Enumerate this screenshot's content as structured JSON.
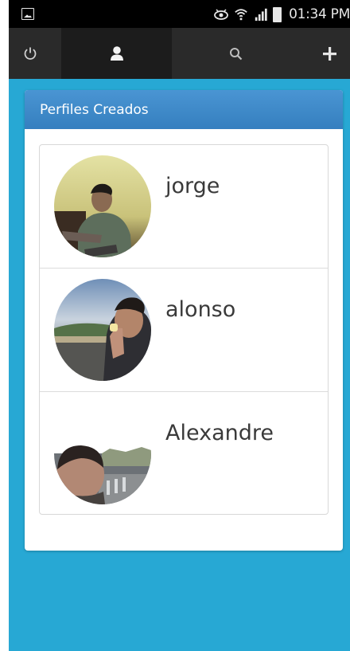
{
  "status_bar": {
    "time": "01:34 PM",
    "icons": [
      "image-notification-icon",
      "eye-icon",
      "wifi-icon",
      "signal-icon",
      "battery-icon"
    ]
  },
  "action_bar": {
    "tabs": [
      {
        "name": "power-icon",
        "active": false
      },
      {
        "name": "user-icon",
        "active": true
      },
      {
        "name": "search-icon",
        "active": false
      },
      {
        "name": "plus-icon",
        "active": false
      }
    ]
  },
  "panel": {
    "title": "Perfiles Creados"
  },
  "profiles": [
    {
      "name": "jorge"
    },
    {
      "name": "alonso"
    },
    {
      "name": "Alexandre"
    }
  ],
  "colors": {
    "background_blue": "#27a8d4",
    "header_blue": "#357fbf",
    "action_bar": "#2a2a2a"
  }
}
